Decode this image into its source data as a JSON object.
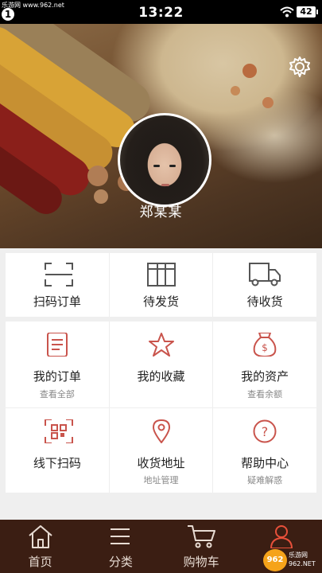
{
  "status_bar": {
    "site": "乐游网 www.962.net",
    "badge": "1",
    "time": "13:22",
    "battery": "42"
  },
  "profile": {
    "username": "郑某某"
  },
  "order_row": [
    {
      "label": "扫码订单",
      "icon": "scan-icon"
    },
    {
      "label": "待发货",
      "icon": "package-icon"
    },
    {
      "label": "待收货",
      "icon": "truck-icon"
    }
  ],
  "features_row1": [
    {
      "label": "我的订单",
      "sub": "查看全部",
      "icon": "order-list-icon"
    },
    {
      "label": "我的收藏",
      "sub": "",
      "icon": "star-icon"
    },
    {
      "label": "我的资产",
      "sub": "查看余额",
      "icon": "money-bag-icon"
    }
  ],
  "features_row2": [
    {
      "label": "线下扫码",
      "sub": "",
      "icon": "qr-scan-icon"
    },
    {
      "label": "收货地址",
      "sub": "地址管理",
      "icon": "location-pin-icon"
    },
    {
      "label": "帮助中心",
      "sub": "疑难解惑",
      "icon": "help-icon"
    }
  ],
  "tabs": [
    {
      "label": "首页",
      "icon": "home-icon"
    },
    {
      "label": "分类",
      "icon": "menu-icon"
    },
    {
      "label": "购物车",
      "icon": "cart-icon"
    },
    {
      "label": "",
      "icon": "user-icon",
      "active": true
    }
  ],
  "watermark": {
    "badge": "962",
    "line1": "乐游网",
    "line2": "962.NET"
  },
  "colors": {
    "accent": "#c9544c",
    "tabbar": "#3b1e13",
    "icon_gray": "#555555"
  }
}
